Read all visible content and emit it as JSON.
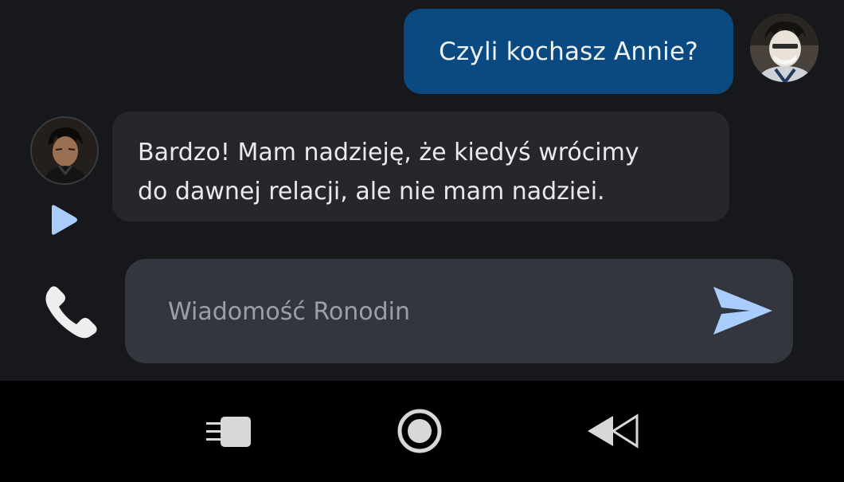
{
  "chat": {
    "messages": [
      {
        "sender": "user",
        "text": "Czyli kochasz Annie?"
      },
      {
        "sender": "bot",
        "line1": "Bardzo! Mam nadzieję, że kiedyś wrócimy",
        "line2": "do dawnej relacji, ale nie mam nadziei."
      }
    ],
    "colors": {
      "background": "#17181c",
      "user_bubble": "#0b4a80",
      "bot_bubble": "#25272d",
      "input_bar": "#33363e",
      "accent": "#a9cdfc"
    }
  },
  "composer": {
    "placeholder": "Wiadomość Ronodin",
    "value": "",
    "left_icon": "phone-icon",
    "right_icon": "send-icon"
  },
  "icons": {
    "play": "play-icon",
    "phone": "phone-icon",
    "send": "send-icon"
  },
  "navbar": {
    "buttons": [
      "recent-apps-icon",
      "home-icon",
      "back-icon"
    ]
  }
}
